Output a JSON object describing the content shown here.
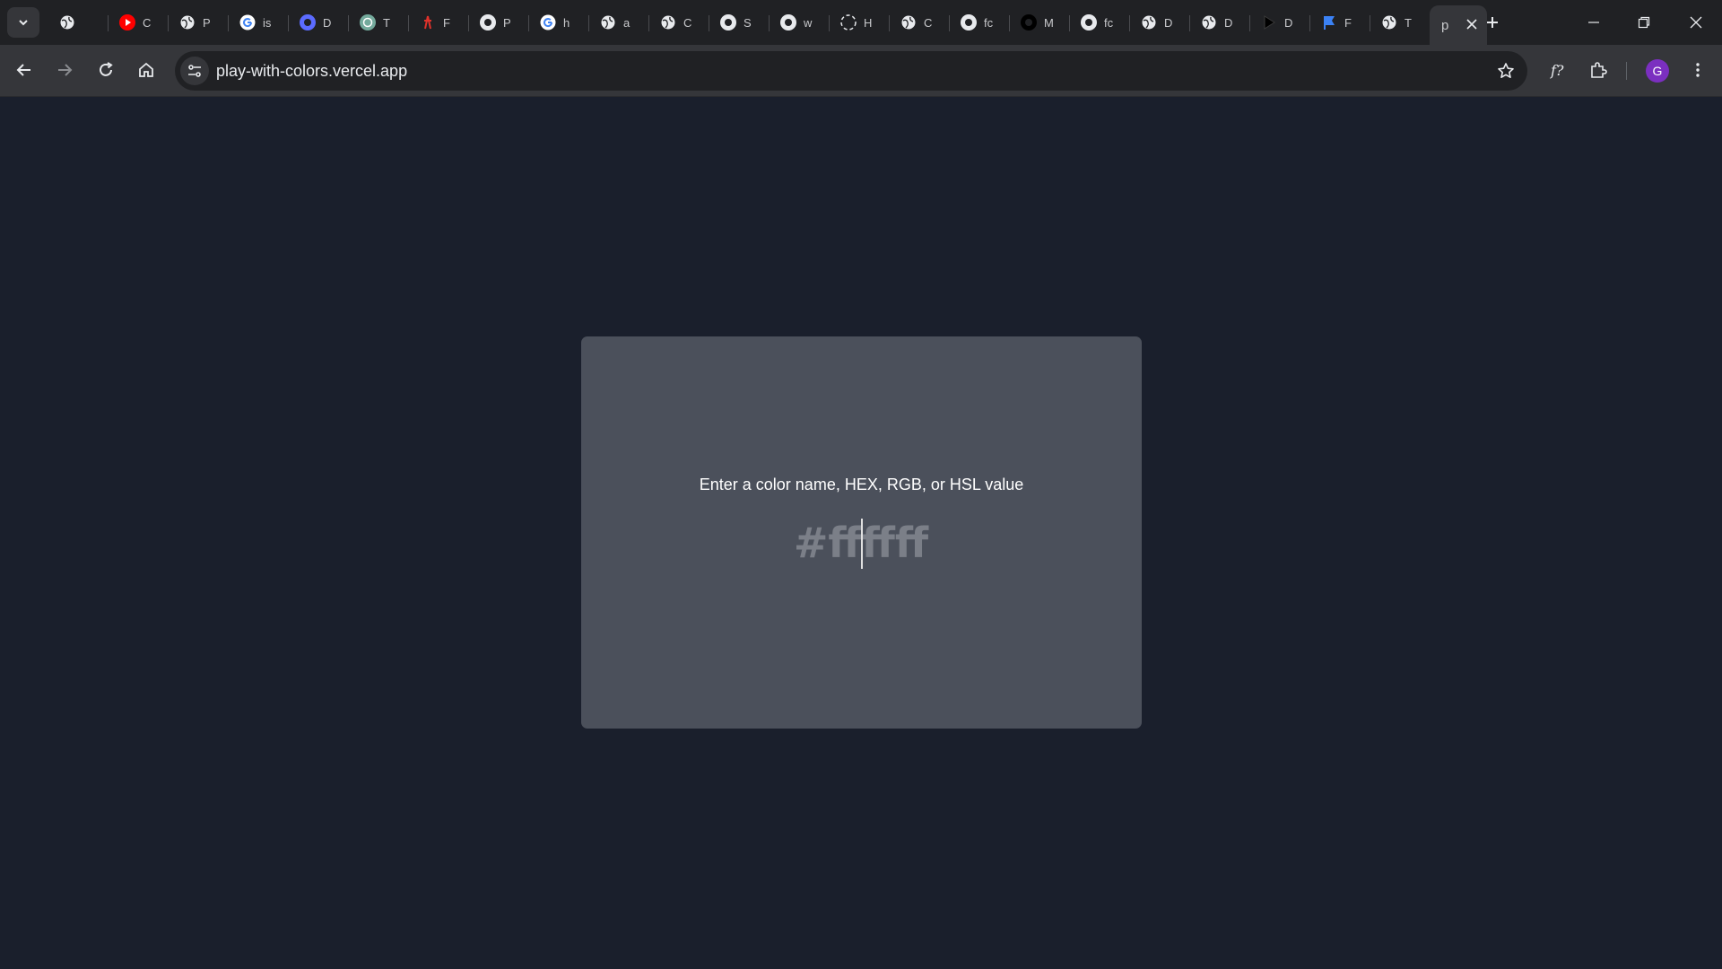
{
  "browser": {
    "tabs": [
      {
        "title": "",
        "icon": "globe-icon",
        "color": "#e8eaed"
      },
      {
        "title": "C",
        "icon": "youtube-icon",
        "color": "#ff0000"
      },
      {
        "title": "P",
        "icon": "globe-icon",
        "color": "#e8eaed"
      },
      {
        "title": "is",
        "icon": "google-icon",
        "color": "#4285f4"
      },
      {
        "title": "D",
        "icon": "app-icon",
        "color": "#5b6bff"
      },
      {
        "title": "T",
        "icon": "chatgpt-icon",
        "color": "#74aa9c"
      },
      {
        "title": "F",
        "icon": "figure-icon",
        "color": "#e0322b"
      },
      {
        "title": "P",
        "icon": "app-icon",
        "color": "#e8eaed"
      },
      {
        "title": "h",
        "icon": "google-icon",
        "color": "#4285f4"
      },
      {
        "title": "a",
        "icon": "globe-icon",
        "color": "#e8eaed"
      },
      {
        "title": "C",
        "icon": "globe-icon",
        "color": "#e8eaed"
      },
      {
        "title": "S",
        "icon": "app-icon",
        "color": "#e8eaed"
      },
      {
        "title": "w",
        "icon": "app-icon",
        "color": "#e8eaed"
      },
      {
        "title": "H",
        "icon": "loading-icon",
        "color": "#e8eaed"
      },
      {
        "title": "C",
        "icon": "globe-icon",
        "color": "#e8eaed"
      },
      {
        "title": "fc",
        "icon": "app-icon",
        "color": "#e8eaed"
      },
      {
        "title": "M",
        "icon": "app-icon",
        "color": "#000000"
      },
      {
        "title": "fc",
        "icon": "app-icon",
        "color": "#e8eaed"
      },
      {
        "title": "D",
        "icon": "globe-icon",
        "color": "#e8eaed"
      },
      {
        "title": "D",
        "icon": "globe-icon",
        "color": "#e8eaed"
      },
      {
        "title": "D",
        "icon": "play-icon",
        "color": "#000000"
      },
      {
        "title": "F",
        "icon": "flag-icon",
        "color": "#3b82f6"
      },
      {
        "title": "T",
        "icon": "globe-icon",
        "color": "#e8eaed"
      },
      {
        "title": "p",
        "icon": "",
        "color": "#e8eaed",
        "active": true
      }
    ],
    "url": "play-with-colors.vercel.app",
    "profile_initial": "G",
    "profile_color": "#7b2fc0"
  },
  "page": {
    "prompt": "Enter a color name, HEX, RGB, or HSL value",
    "input_value": "#ffffff"
  },
  "colors": {
    "background": "#1a1f2c",
    "card": "#4b505b",
    "input_text": "#7b7f88"
  }
}
